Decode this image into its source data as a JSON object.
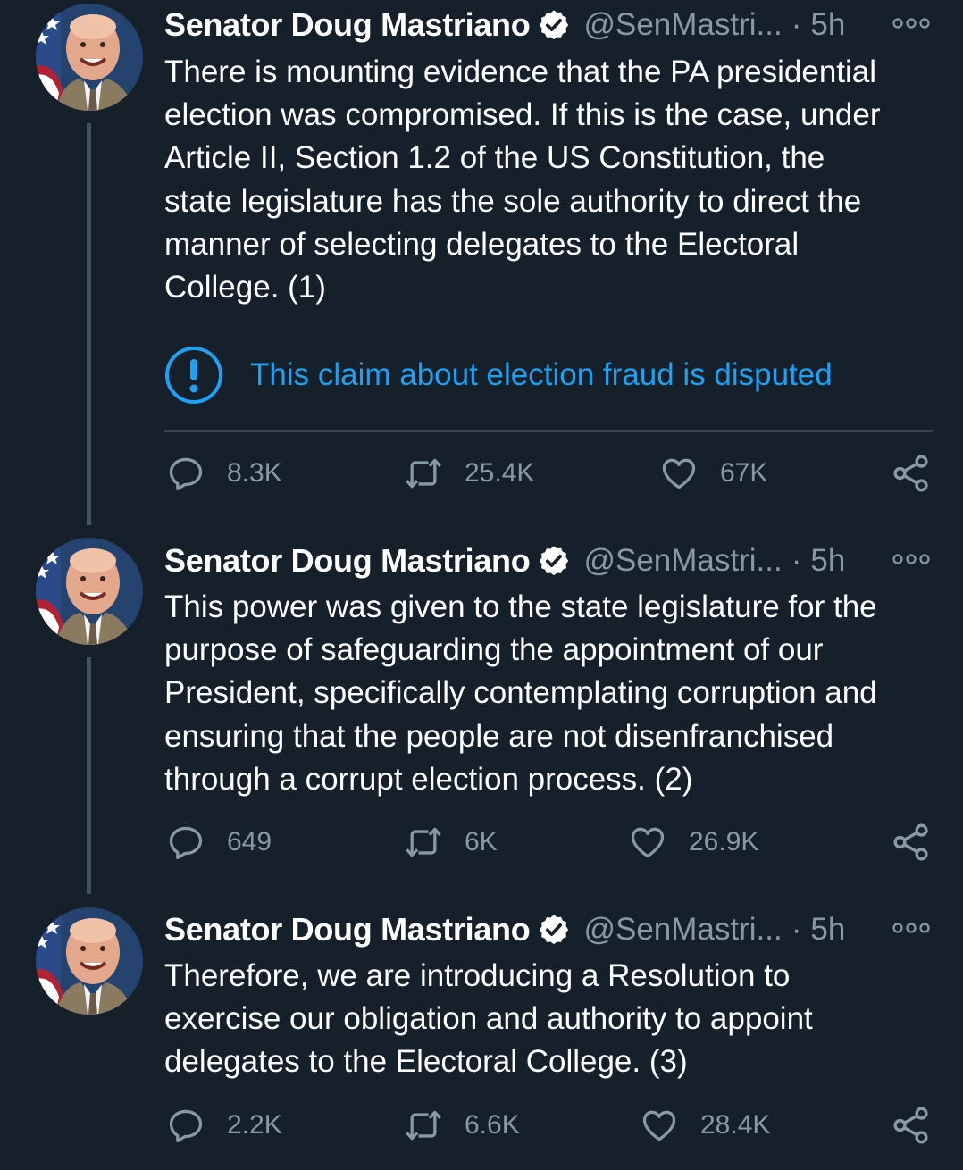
{
  "colors": {
    "background": "#15202b",
    "text": "#ffffff",
    "muted": "#8899a6",
    "accent": "#1da1f2",
    "thread_line": "#3d5466",
    "divider": "#38444d"
  },
  "tweets": [
    {
      "author_name": "Senator Doug Mastriano",
      "handle": "@SenMastri...",
      "separator": "·",
      "time": "5h",
      "text": "There is mounting evidence that the PA presidential\nelection was compromised.  If this is the case, under\nArticle II, Section 1.2 of the US Constitution, the\nstate legislature has the sole authority to direct the\nmanner of selecting delegates to the Electoral\nCollege. (1)",
      "notice": "This claim about election fraud is disputed",
      "replies": "8.3K",
      "retweets": "25.4K",
      "likes": "67K",
      "icons": [
        "verified-badge-icon",
        "more-icon",
        "info-icon",
        "reply-icon",
        "retweet-icon",
        "like-icon",
        "share-icon"
      ]
    },
    {
      "author_name": "Senator Doug Mastriano",
      "handle": "@SenMastri...",
      "separator": "·",
      "time": "5h",
      "text": "This power was given to the state legislature for the\npurpose of safeguarding the appointment of our\nPresident, specifically contemplating corruption and\nensuring that the people are not disenfranchised\nthrough a corrupt election process. (2)",
      "replies": "649",
      "retweets": "6K",
      "likes": "26.9K"
    },
    {
      "author_name": "Senator Doug Mastriano",
      "handle": "@SenMastri...",
      "separator": "·",
      "time": "5h",
      "text": "Therefore, we are introducing a Resolution to\nexercise our obligation and authority to appoint\ndelegates to the Electoral College. (3)",
      "replies": "2.2K",
      "retweets": "6.6K",
      "likes": "28.4K"
    }
  ]
}
